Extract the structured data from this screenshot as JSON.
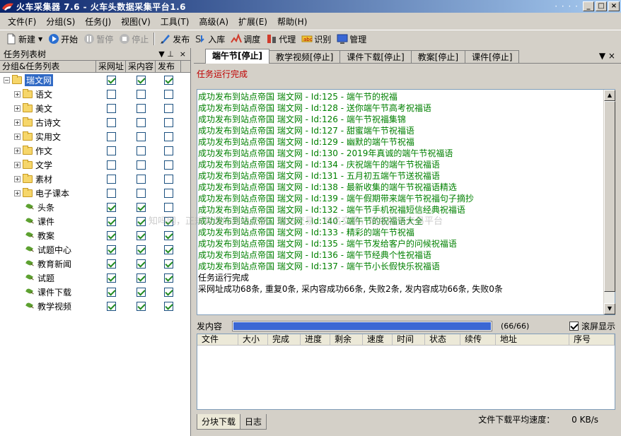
{
  "window": {
    "title": "火车采集器 7.6 - 火车头数据采集平台1.6",
    "dots": "· · · ·",
    "min": "_",
    "max": "□",
    "close": "×"
  },
  "menu": [
    "文件(F)",
    "分组(S)",
    "任务(J)",
    "视图(V)",
    "工具(T)",
    "高级(A)",
    "扩展(E)",
    "帮助(H)"
  ],
  "toolbar": {
    "new": "新建",
    "start": "开始",
    "pause": "暂停",
    "stop": "停止",
    "publish": "发布",
    "import": "入库",
    "debug": "调度",
    "proxy": "代理",
    "recognize": "识别",
    "manage": "管理"
  },
  "left_panel": {
    "title": "任务列表树",
    "pin": "▼  ⊥",
    "close": "×",
    "columns": [
      "分组&任务列表",
      "采网址",
      "采内容",
      "发布"
    ],
    "rows": [
      {
        "label": "瑞文网",
        "type": "root",
        "checks": [
          true,
          true,
          true
        ]
      },
      {
        "label": "语文",
        "type": "folder",
        "checks": [
          false,
          false,
          false
        ]
      },
      {
        "label": "美文",
        "type": "folder",
        "checks": [
          false,
          false,
          false
        ]
      },
      {
        "label": "古诗文",
        "type": "folder",
        "checks": [
          false,
          false,
          false
        ]
      },
      {
        "label": "实用文",
        "type": "folder",
        "checks": [
          false,
          false,
          false
        ]
      },
      {
        "label": "作文",
        "type": "folder",
        "checks": [
          false,
          false,
          false
        ]
      },
      {
        "label": "文学",
        "type": "folder",
        "checks": [
          false,
          false,
          false
        ]
      },
      {
        "label": "素材",
        "type": "folder",
        "checks": [
          false,
          false,
          false
        ]
      },
      {
        "label": "电子课本",
        "type": "folder",
        "checks": [
          false,
          false,
          false
        ]
      },
      {
        "label": "头条",
        "type": "task",
        "checks": [
          true,
          true,
          false
        ]
      },
      {
        "label": "课件",
        "type": "task",
        "checks": [
          true,
          true,
          true
        ]
      },
      {
        "label": "教案",
        "type": "task",
        "checks": [
          true,
          true,
          true
        ]
      },
      {
        "label": "试题中心",
        "type": "task",
        "checks": [
          true,
          true,
          true
        ]
      },
      {
        "label": "教育新闻",
        "type": "task",
        "checks": [
          true,
          true,
          true
        ]
      },
      {
        "label": "试题",
        "type": "task",
        "checks": [
          true,
          true,
          true
        ]
      },
      {
        "label": "课件下载",
        "type": "task",
        "checks": [
          true,
          true,
          true
        ]
      },
      {
        "label": "教学视频",
        "type": "task",
        "checks": [
          true,
          true,
          true
        ]
      }
    ]
  },
  "tabs": [
    "端午节[停止]",
    "教学视频[停止]",
    "课件下载[停止]",
    "教案[停止]",
    "课件[停止]"
  ],
  "tab_ctrl": "▼  ×",
  "run_status": "任务运行完成",
  "log_lines": [
    {
      "text": "成功发布到站点帝国 瑞文网 - Id:125 - 端午节的祝福",
      "color": "green"
    },
    {
      "text": "成功发布到站点帝国 瑞文网 - Id:128 - 送你端午节高考祝福语",
      "color": "green"
    },
    {
      "text": "成功发布到站点帝国 瑞文网 - Id:126 - 端午节祝福集锦",
      "color": "green"
    },
    {
      "text": "成功发布到站点帝国 瑞文网 - Id:127 - 甜蜜端午节祝福语",
      "color": "green"
    },
    {
      "text": "成功发布到站点帝国 瑞文网 - Id:129 - 幽默的端午节祝福",
      "color": "green"
    },
    {
      "text": "成功发布到站点帝国 瑞文网 - Id:130 - 2019年真诚的端午节祝福语",
      "color": "green"
    },
    {
      "text": "成功发布到站点帝国 瑞文网 - Id:134 - 庆祝端午的端午节祝福语",
      "color": "green"
    },
    {
      "text": "成功发布到站点帝国 瑞文网 - Id:131 - 五月初五端午节送祝福语",
      "color": "green"
    },
    {
      "text": "成功发布到站点帝国 瑞文网 - Id:138 - 最新收集的端午节祝福语精选",
      "color": "green"
    },
    {
      "text": "成功发布到站点帝国 瑞文网 - Id:139 - 端午假期带来端午节祝福句子摘抄",
      "color": "green"
    },
    {
      "text": "成功发布到站点帝国 瑞文网 - Id:132 - 端午节手机祝福短信经典祝福语",
      "color": "green"
    },
    {
      "text": "成功发布到站点帝国 瑞文网 - Id:140 - 端午节的祝福语大全",
      "color": "green"
    },
    {
      "text": "成功发布到站点帝国 瑞文网 - Id:133 - 精彩的端午节祝福",
      "color": "green"
    },
    {
      "text": "成功发布到站点帝国 瑞文网 - Id:135 - 端午节发给客户的问候祝福语",
      "color": "green"
    },
    {
      "text": "成功发布到站点帝国 瑞文网 - Id:136 - 端午节经典个性祝福语",
      "color": "green"
    },
    {
      "text": "成功发布到站点帝国 瑞文网 - Id:137 - 端午节小长假快乐祝福语",
      "color": "green"
    },
    {
      "text": "任务运行完成",
      "color": "black"
    },
    {
      "text": "采网址成功68条, 重复0条, 采内容成功66条, 失败2条, 发内容成功66条, 失败0条",
      "color": "black"
    }
  ],
  "watermark": "知吗网，正规靠谱的源码交易、网站交易，域名交易，网络服务交易平台",
  "progress": {
    "label": "发内容",
    "count": "(66/66)",
    "fraction": 1.0,
    "scroll_label": "滚屏显示",
    "scroll_checked": true
  },
  "download_columns": [
    "文件",
    "大小",
    "完成",
    "进度",
    "剩余",
    "速度",
    "时间",
    "状态",
    "续传",
    "地址",
    "序号"
  ],
  "bottom_tabs": [
    "分块下载",
    "日志"
  ],
  "speed_label": "文件下载平均速度：",
  "speed_value": "0 KB/s",
  "colors": {
    "green": "#008000",
    "black": "#000000",
    "progress": "#3a67d4",
    "titlebar": "#0a246a"
  }
}
